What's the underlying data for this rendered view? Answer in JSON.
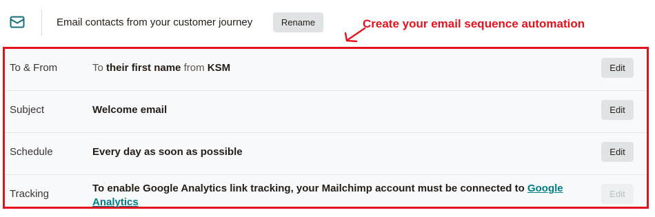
{
  "header": {
    "icon": "mail-icon",
    "title": "Email contacts from your customer journey",
    "rename_label": "Rename"
  },
  "annotation": {
    "text": "Create your email sequence automation",
    "color": "#e5111c"
  },
  "rows": {
    "to_from": {
      "label": "To & From",
      "prefix": "To",
      "recipient": "their first name",
      "middle": "from",
      "sender": "KSM",
      "edit_label": "Edit"
    },
    "subject": {
      "label": "Subject",
      "value": "Welcome email",
      "edit_label": "Edit"
    },
    "schedule": {
      "label": "Schedule",
      "value": "Every day as soon as possible",
      "edit_label": "Edit"
    },
    "tracking": {
      "label": "Tracking",
      "text": "To enable Google Analytics link tracking, your Mailchimp account must be connected to",
      "link": "Google Analytics",
      "edit_label": "Edit",
      "edit_disabled": true
    }
  },
  "colors": {
    "highlight_border": "#e3111d",
    "link": "#007c89",
    "button_bg": "#dfe3e4"
  }
}
